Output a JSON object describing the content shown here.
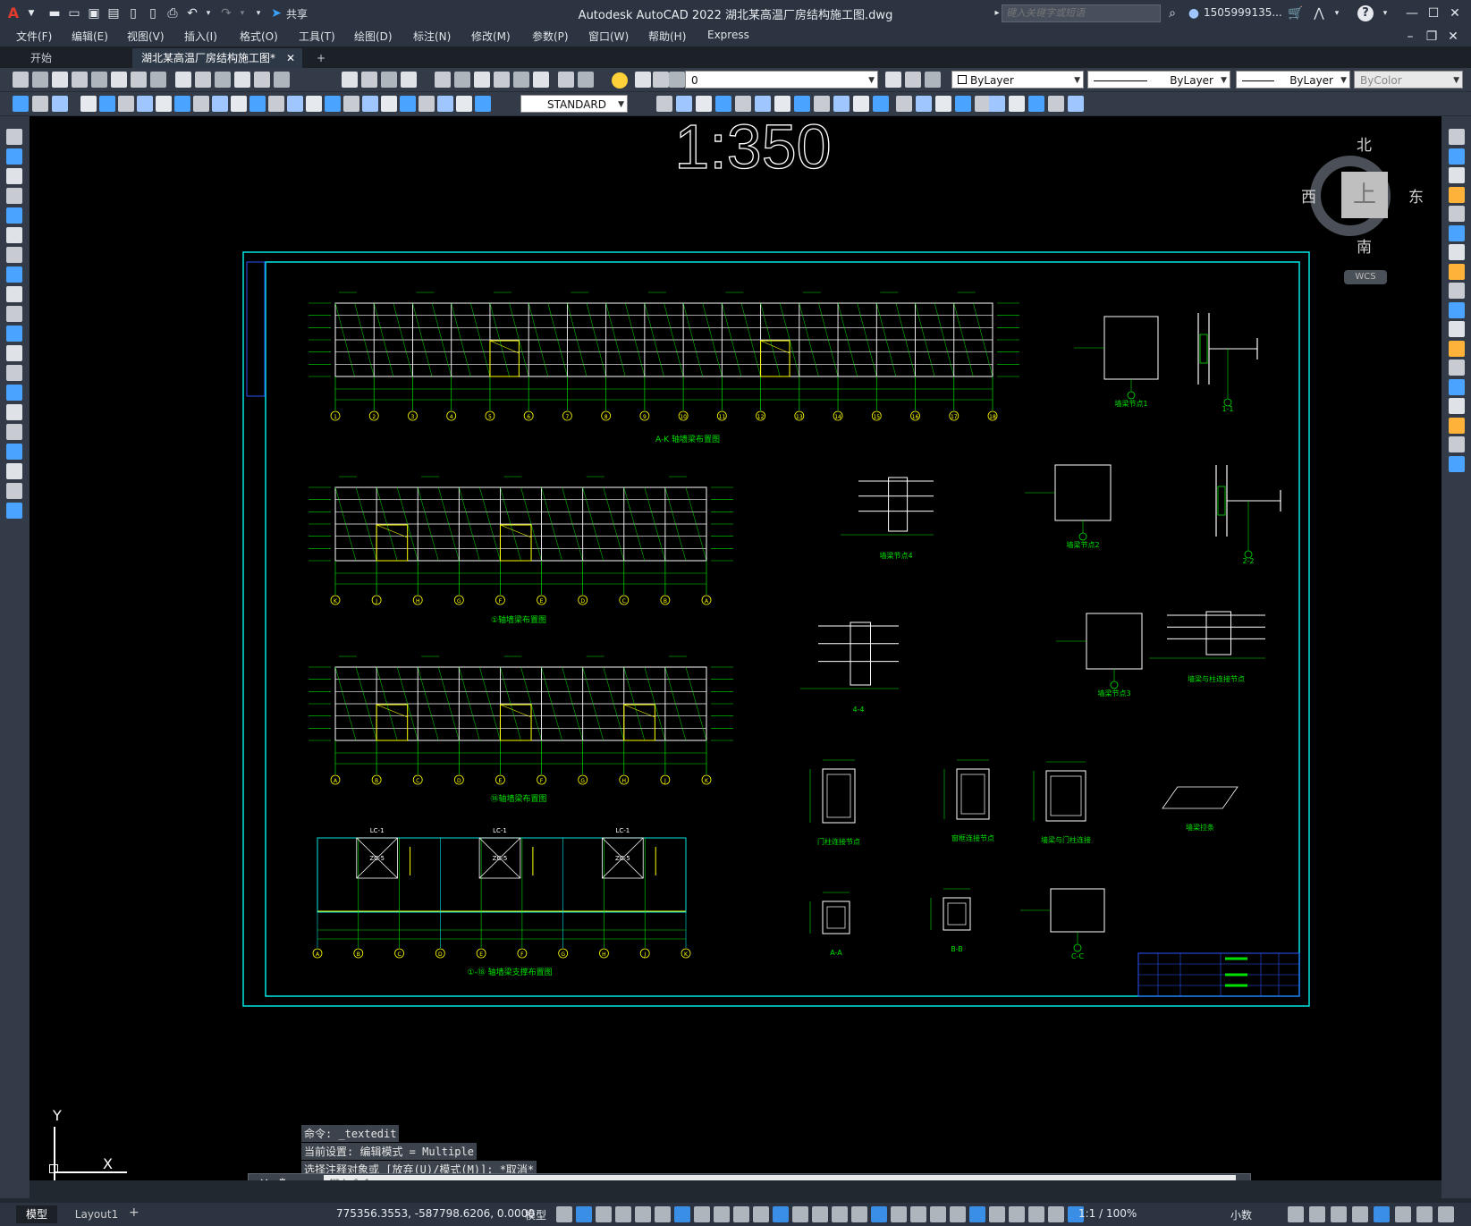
{
  "window": {
    "app_title": "Autodesk AutoCAD 2022    湖北某高温厂房结构施工图.dwg",
    "app_icon": "A",
    "share_label": "共享",
    "search_placeholder": "键入关键字或短语",
    "user": "1505999135...",
    "help_label": "?"
  },
  "menu": [
    "文件(F)",
    "编辑(E)",
    "视图(V)",
    "插入(I)",
    "格式(O)",
    "工具(T)",
    "绘图(D)",
    "标注(N)",
    "修改(M)",
    "参数(P)",
    "窗口(W)",
    "帮助(H)",
    "Express"
  ],
  "tabs": {
    "start": "开始",
    "drawing": "湖北某高温厂房结构施工图*",
    "close": "✕",
    "add": "+"
  },
  "toolbar": {
    "layer": "0",
    "color": "ByLayer",
    "linetype": "ByLayer",
    "lineweight": "ByLayer",
    "plotstyle": "ByColor",
    "textstyle": "STANDARD"
  },
  "viewcube": {
    "north": "北",
    "south": "南",
    "east": "东",
    "west": "西",
    "face": "上",
    "wcs": "WCS"
  },
  "drawing": {
    "scale_label": "1:350",
    "elev_axes_top": [
      "1",
      "2",
      "3",
      "4",
      "5",
      "6",
      "7",
      "8",
      "9",
      "10",
      "11",
      "12",
      "13",
      "14",
      "15",
      "16",
      "17",
      "18"
    ],
    "elev_axes_mid": [
      "K",
      "J",
      "H",
      "G",
      "F",
      "E",
      "D",
      "C",
      "B",
      "A"
    ],
    "elev_axes_low": [
      "A",
      "B",
      "C",
      "D",
      "E",
      "F",
      "G",
      "H",
      "J",
      "K"
    ],
    "bottom_plan_axes": [
      "A",
      "B",
      "C",
      "D",
      "E",
      "F",
      "G",
      "H",
      "J",
      "K"
    ],
    "lc_label": "LC-1",
    "zc_label": "ZC-5",
    "title_elev1": "A-K 轴墙梁布置图",
    "title_elev2": "①轴墙梁布置图",
    "title_elev3": "⑱轴墙梁布置图",
    "title_plan": "①-⑱ 轴墙梁支撑布置图",
    "details": [
      "墙梁节点1",
      "1-1",
      "墙梁节点4",
      "墙梁节点2",
      "2-2",
      "4-4",
      "墙梁节点3",
      "墙梁与柱连接节点",
      "门柱连接节点",
      "窗框连接节点",
      "墙梁与门柱连接",
      "墙梁拉条",
      "A-A",
      "B-B",
      "C-C"
    ]
  },
  "command": {
    "history": [
      "命令: _textedit",
      "当前设置: 编辑模式 = Multiple",
      "选择注释对象或 [放弃(U)/模式(M)]: *取消*"
    ],
    "placeholder": "键入命令"
  },
  "ucs": {
    "x": "X",
    "y": "Y"
  },
  "status": {
    "model_tab": "模型",
    "layout_tab": "Layout1",
    "coords": "775356.3553, -587798.6206, 0.0000",
    "space": "模型",
    "scale": "1:1 / 100%",
    "units": "小数"
  },
  "colors": {
    "accent": "#00c8ff",
    "frame": "#00e5e5",
    "beam": "#00e000",
    "axis": "#ffff00",
    "white": "#ffffff"
  }
}
